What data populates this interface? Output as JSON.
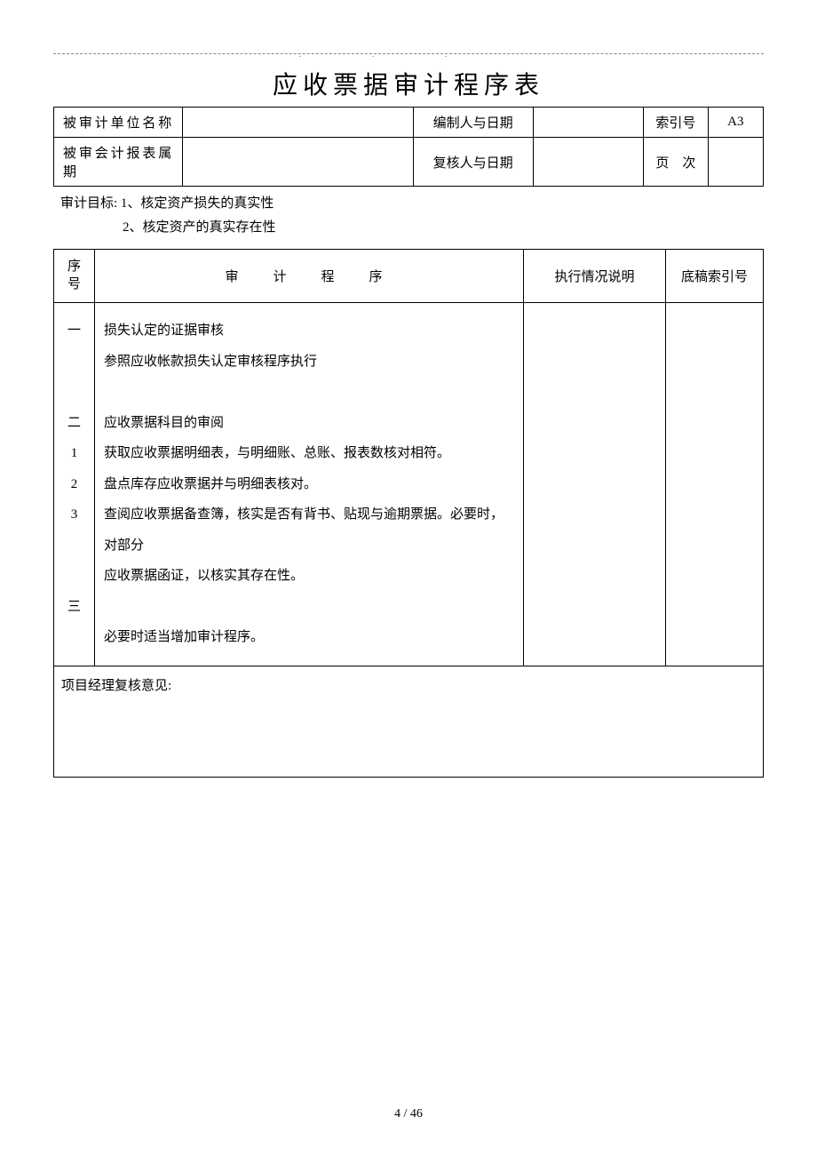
{
  "title": "应收票据审计程序表",
  "header": {
    "unit_label": "被审计单位名称",
    "unit_value": "",
    "preparer_label": "编制人与日期",
    "preparer_value": "",
    "index_label": "索引号",
    "index_value": "A3",
    "period_label": "被审会计报表属期",
    "period_value": "",
    "reviewer_label": "复核人与日期",
    "reviewer_value": "",
    "page_label": "页　次",
    "page_value": ""
  },
  "goals": {
    "prefix": "审计目标: ",
    "line1": "1、核定资产损失的真实性",
    "line2": "2、核定资产的真实存在性"
  },
  "columns": {
    "seq_line1": "序",
    "seq_line2": "号",
    "procedure": "审　计　程　序",
    "execution": "执行情况说明",
    "index": "底稿索引号"
  },
  "rows": [
    {
      "seq": "一",
      "text": "损失认定的证据审核"
    },
    {
      "seq": "",
      "text": "参照应收帐款损失认定审核程序执行"
    },
    {
      "seq": "",
      "text": ""
    },
    {
      "seq": "二",
      "text": "应收票据科目的审阅"
    },
    {
      "seq": "1",
      "text": "获取应收票据明细表，与明细账、总账、报表数核对相符。"
    },
    {
      "seq": "2",
      "text": "盘点库存应收票据并与明细表核对。"
    },
    {
      "seq": "3",
      "text": "查阅应收票据备查簿，核实是否有背书、贴现与逾期票据。必要时，对部分"
    },
    {
      "seq": "",
      "text": "应收票据函证，以核实其存在性。"
    },
    {
      "seq": "",
      "text": ""
    },
    {
      "seq": "三",
      "text": "必要时适当增加审计程序。"
    }
  ],
  "review_label": "项目经理复核意见:",
  "page_number": "4 / 46"
}
